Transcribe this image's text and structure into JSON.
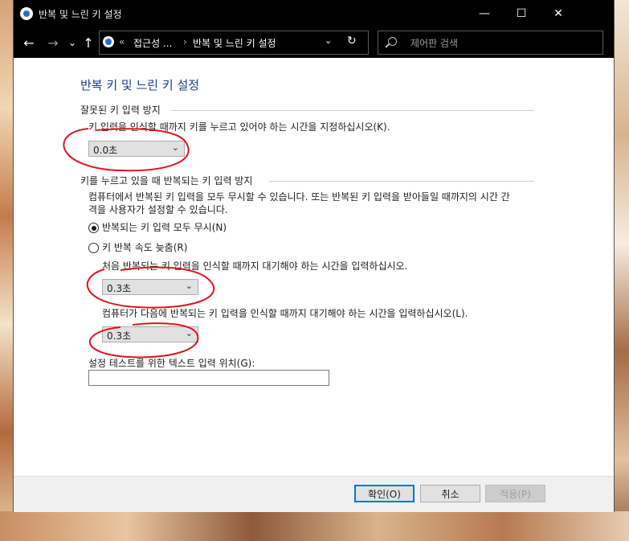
{
  "window": {
    "title": "반복 및 느린 키 설정",
    "minimize": "—",
    "maximize": "☐",
    "close": "✕"
  },
  "nav": {
    "back": "←",
    "forward": "→",
    "recent": "⌄",
    "up": "↑",
    "breadcrumb_sep": "«",
    "crumbs": [
      "접근성 ...",
      "반복 및 느린 키 설정"
    ],
    "crumb_sep": "›",
    "dropdown": "⌄",
    "refresh": "↻",
    "search_placeholder": "제어판 검색"
  },
  "page": {
    "title": "반복 키 및 느린 키 설정",
    "slow_keys": {
      "section": "잘못된 키 입력 방지",
      "desc": "키 입력을 인식할 때까지 키를 누르고 있어야 하는 시간을 지정하십시오(K).",
      "value": "0.0초"
    },
    "repeat_keys": {
      "section": "키를 누르고 있을 때 반복되는 키 입력 방지",
      "desc_line1": "컴퓨터에서 반복된 키 입력을 모두 무시할 수 있습니다. 또는 반복된 키 입력을 받아들일 때까지의 시간 간",
      "desc_line2": "격을 사용자가 설정할 수 있습니다.",
      "option_ignore": "반복되는 키 입력 모두 무시(N)",
      "option_slow": "키 반복 속도 늦춤(R)",
      "first_delay_desc": "처음 반복되는 키 입력을 인식할 때까지 대기해야 하는 시간을 입력하십시오.",
      "first_delay_value": "0.3초",
      "next_delay_desc": "컴퓨터가 다음에 반복되는 키 입력을 인식할 때까지 대기해야 하는 시간을 입력하십시오(L).",
      "next_delay_value": "0.3초"
    },
    "test_label": "설정 테스트를 위한 텍스트 입력 위치(G):",
    "test_value": ""
  },
  "footer": {
    "ok": "확인(O)",
    "cancel": "취소",
    "apply": "적용(P)"
  },
  "colors": {
    "title_blue": "#1c3e8e",
    "annotation_red": "#e0141e",
    "default_button": "#0078d7"
  }
}
